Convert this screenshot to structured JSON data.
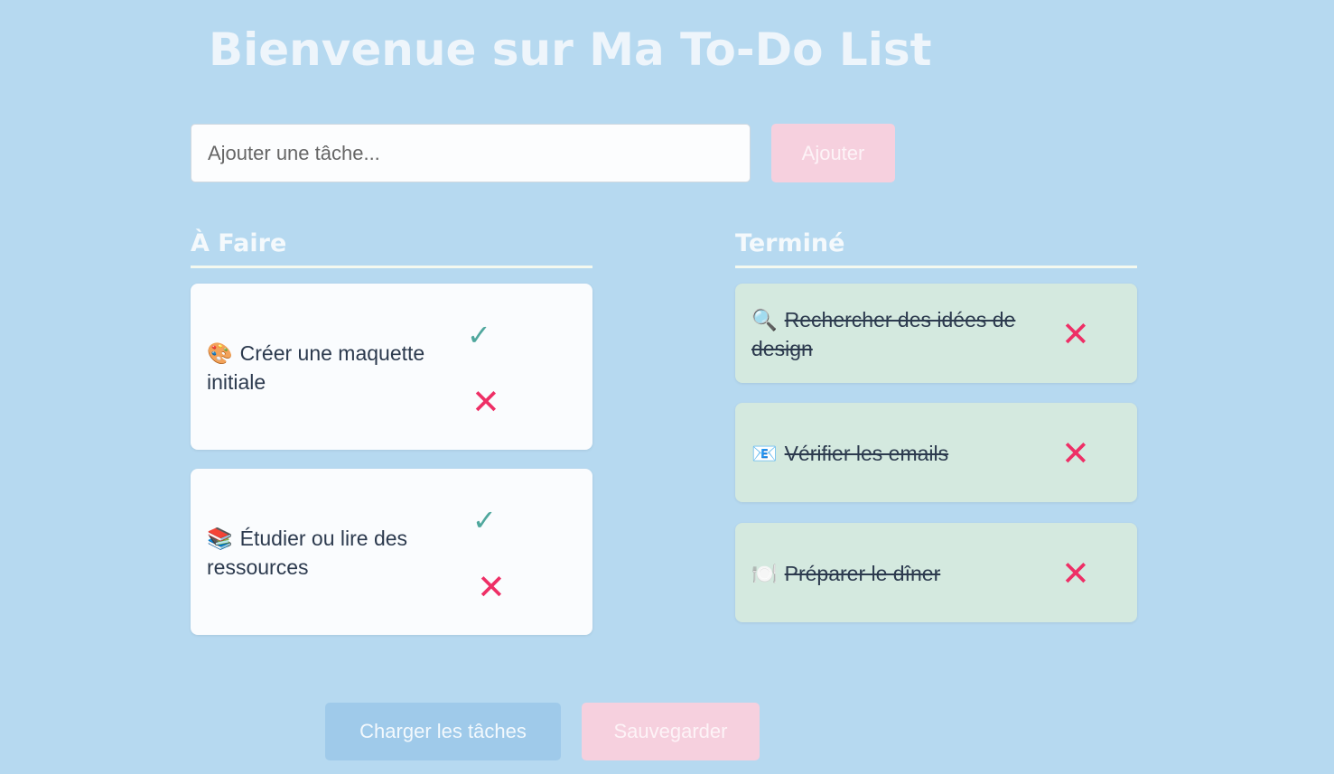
{
  "header": {
    "title": "Bienvenue sur Ma To-Do List"
  },
  "add_form": {
    "placeholder": "Ajouter une tâche...",
    "value": "",
    "add_label": "Ajouter"
  },
  "todo": {
    "title": "À Faire",
    "tasks": [
      {
        "emoji": "🎨",
        "text": "Créer une maquette initiale"
      },
      {
        "emoji": "📚",
        "text": "Étudier ou lire des ressources"
      }
    ]
  },
  "done": {
    "title": "Terminé",
    "tasks": [
      {
        "emoji": "🔍",
        "text": "Rechercher des idées de design"
      },
      {
        "emoji": "📧",
        "text": "Vérifier les emails"
      },
      {
        "emoji": "🍽️",
        "text": "Préparer le dîner"
      }
    ]
  },
  "actions": {
    "check_symbol": "✓",
    "delete_symbol": "✕",
    "load_label": "Charger les tâches",
    "save_label": "Sauvegarder"
  },
  "colors": {
    "background": "#b6d9f0",
    "accent_pink": "#f6d0de",
    "accent_blue": "#9fcaea",
    "check_green": "#4fa79d",
    "delete_red": "#ee2f66",
    "done_card": "#d4e9df"
  }
}
